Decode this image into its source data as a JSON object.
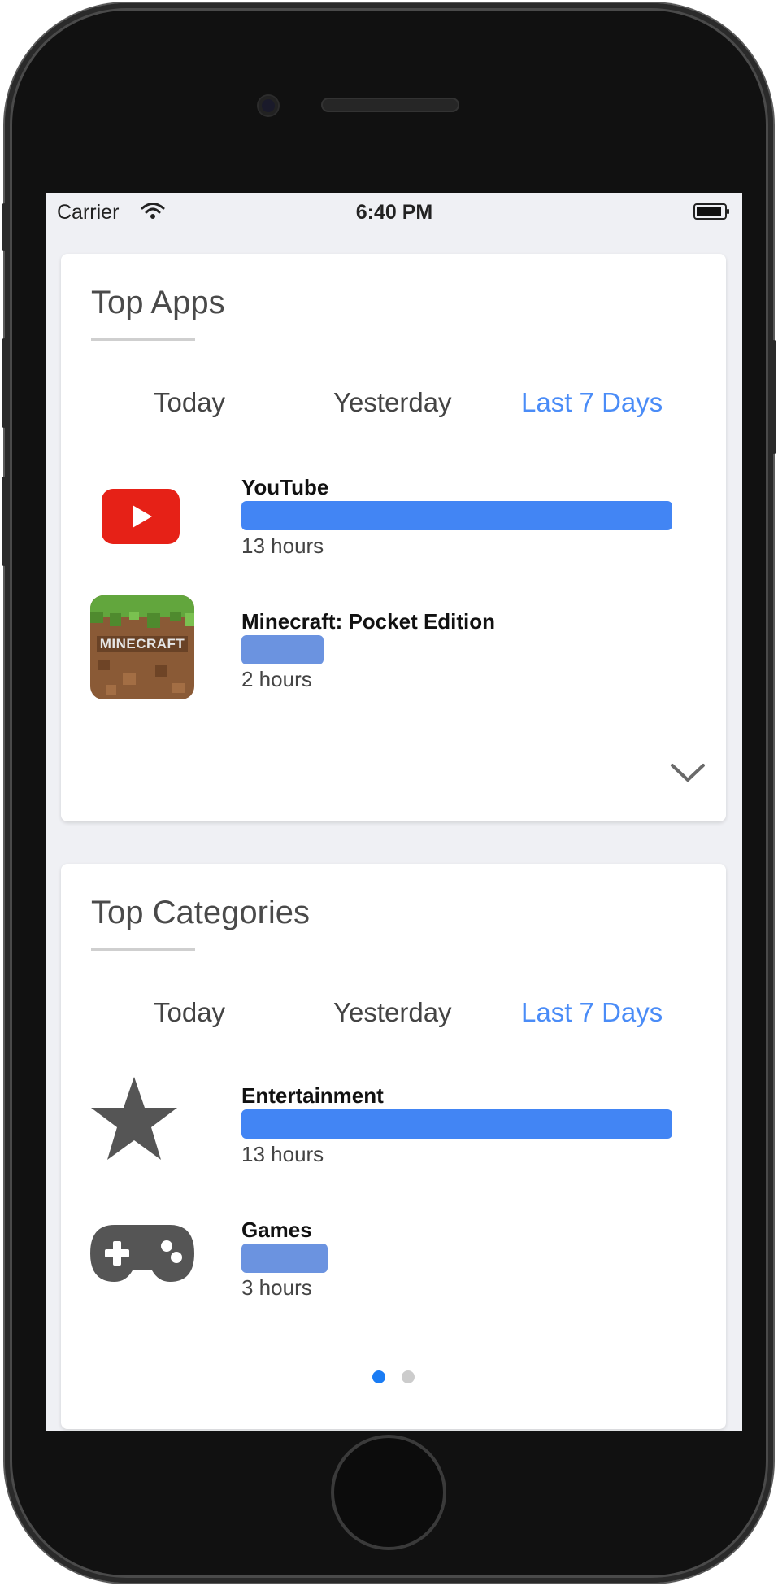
{
  "status_bar": {
    "carrier": "Carrier",
    "time": "6:40 PM",
    "wifi_icon": "wifi-icon",
    "battery_icon": "battery-icon"
  },
  "top_apps": {
    "title": "Top Apps",
    "tabs": [
      {
        "label": "Today",
        "active": false
      },
      {
        "label": "Yesterday",
        "active": false
      },
      {
        "label": "Last 7 Days",
        "active": true
      }
    ],
    "rows": [
      {
        "name": "YouTube",
        "time": "13 hours",
        "icon": "youtube-icon",
        "bar_fraction": 1.0,
        "bar_color": "#4285f4"
      },
      {
        "name": "Minecraft: Pocket Edition",
        "time": "2 hours",
        "icon": "minecraft-icon",
        "bar_fraction": 0.19,
        "bar_color": "#6b93e0"
      }
    ],
    "expand_icon": "chevron-down-icon"
  },
  "top_categories": {
    "title": "Top Categories",
    "tabs": [
      {
        "label": "Today",
        "active": false
      },
      {
        "label": "Yesterday",
        "active": false
      },
      {
        "label": "Last 7 Days",
        "active": true
      }
    ],
    "rows": [
      {
        "name": "Entertainment",
        "time": "13 hours",
        "icon": "star-icon",
        "bar_fraction": 1.0,
        "bar_color": "#4285f4"
      },
      {
        "name": "Games",
        "time": "3 hours",
        "icon": "gamepad-icon",
        "bar_fraction": 0.2,
        "bar_color": "#6b93e0"
      }
    ]
  },
  "pagination": {
    "count": 2,
    "active_index": 0,
    "active_color": "#1a7cf4",
    "inactive_color": "#cccccc"
  },
  "colors": {
    "accent": "#4a8cf7",
    "screen_bg": "#eff0f4",
    "icon_gray": "#555555",
    "youtube_red": "#e62117"
  }
}
